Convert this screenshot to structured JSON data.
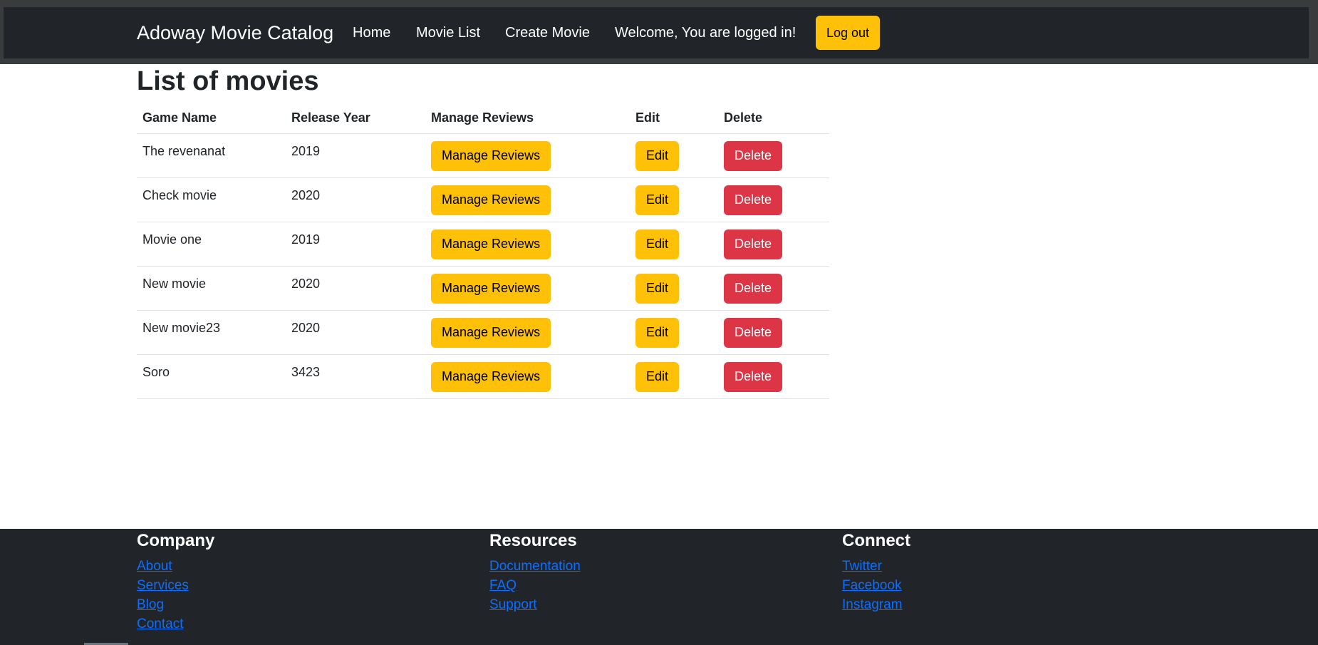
{
  "navbar": {
    "brand": "Adoway Movie Catalog",
    "links": [
      "Home",
      "Movie List",
      "Create Movie"
    ],
    "welcome": "Welcome, You are logged in!",
    "logout_label": "Log out"
  },
  "main": {
    "title": "List of movies",
    "columns": [
      "Game Name",
      "Release Year",
      "Manage Reviews",
      "Edit",
      "Delete"
    ],
    "rows": [
      {
        "name": "The revenanat",
        "year": "2019"
      },
      {
        "name": "Check movie",
        "year": "2020"
      },
      {
        "name": "Movie one",
        "year": "2019"
      },
      {
        "name": "New movie",
        "year": "2020"
      },
      {
        "name": "New movie23",
        "year": "2020"
      },
      {
        "name": "Soro",
        "year": "3423"
      }
    ],
    "buttons": {
      "manage": "Manage Reviews",
      "edit": "Edit",
      "delete": "Delete"
    }
  },
  "footer": {
    "company": {
      "heading": "Company",
      "links": [
        "About",
        "Services",
        "Blog",
        "Contact"
      ]
    },
    "resources": {
      "heading": "Resources",
      "links": [
        "Documentation",
        "FAQ",
        "Support"
      ]
    },
    "connect": {
      "heading": "Connect",
      "links": [
        "Twitter",
        "Facebook",
        "Instagram"
      ]
    }
  },
  "colors": {
    "navbar_bg": "#212529",
    "warning": "#ffc107",
    "danger": "#dc3545",
    "link": "#0d6efd"
  }
}
